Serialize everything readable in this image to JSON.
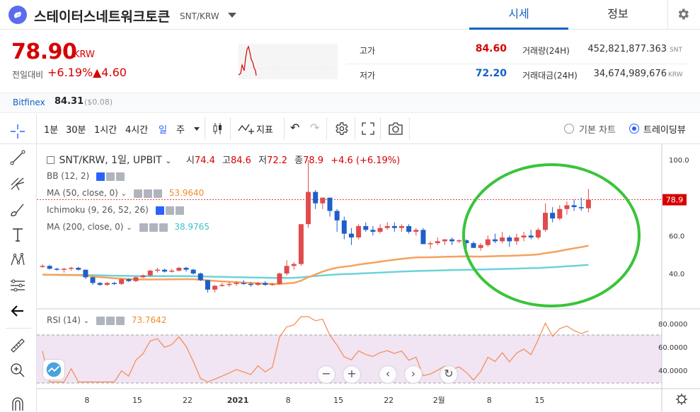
{
  "header": {
    "coin_name": "스테이터스네트워크토큰",
    "pair": "SNT/KRW",
    "tabs": [
      "시세",
      "정보"
    ]
  },
  "price": {
    "current": "78.90",
    "unit": "KRW",
    "change_label": "전일대비",
    "change_pct": "+6.19%",
    "change_abs": "▲4.60"
  },
  "stats": {
    "high_label": "고가",
    "high": "84.60",
    "low_label": "저가",
    "low": "72.20",
    "volume_label": "거래량(24H)",
    "volume": "452,821,877.363",
    "volume_unit": "SNT",
    "value_label": "거래대금(24H)",
    "value": "34,674,989,676",
    "value_unit": "KRW"
  },
  "bitfinex": {
    "name": "Bitfinex",
    "price": "84.31",
    "usd": "($0.08)"
  },
  "toolbar": {
    "intervals": [
      "1분",
      "30분",
      "1시간",
      "4시간",
      "일",
      "주"
    ],
    "active_interval": "일",
    "indicators_label": "지표",
    "basic_chart": "기본 차트",
    "tradingview": "트레이딩뷰"
  },
  "legend": {
    "symbol": "SNT/KRW, 1일, UPBIT",
    "open_lbl": "시",
    "open": "74.4",
    "high_lbl": "고",
    "high": "84.6",
    "low_lbl": "저",
    "low": "72.2",
    "close_lbl": "종",
    "close": "78.9",
    "change": "+4.6 (+6.19%)",
    "bb": "BB (12, 2)",
    "ma50": "MA (50, close, 0)",
    "ma50_val": "53.9640",
    "ichimoku": "Ichimoku (9, 26, 52, 26)",
    "ma200": "MA (200, close, 0)",
    "ma200_val": "38.9765",
    "rsi": "RSI (14)",
    "rsi_val": "73.7642"
  },
  "colors": {
    "up": "#d60000",
    "candle_up": "#e04b4b",
    "candle_down": "#1e5fc9",
    "ma50": "#f5a25d",
    "ma200": "#6dd3d9",
    "rsi": "#f48a50",
    "rsi_band": "#f1e4f3",
    "highlight": "#3ac43a",
    "accent": "#1261c4"
  },
  "chart_data": {
    "type": "candlestick",
    "price_axis": {
      "ticks": [
        100.0,
        80.0,
        60.0,
        40.0
      ],
      "labels": [
        "100.0",
        "80.0",
        "60.0",
        "40.0"
      ],
      "last_price": "78.9"
    },
    "rsi_axis": {
      "ticks": [
        80,
        60,
        40
      ],
      "labels": [
        "80.0000",
        "60.0000",
        "40.0000"
      ]
    },
    "x_ticks": [
      "8",
      "15",
      "22",
      "2021",
      "8",
      "15",
      "22",
      "2월",
      "8",
      "15"
    ],
    "candles": [
      [
        44,
        45,
        43,
        44
      ],
      [
        44,
        44.5,
        42,
        42.5
      ],
      [
        42.5,
        43,
        41.5,
        42
      ],
      [
        42,
        43,
        40.5,
        42.5
      ],
      [
        42.5,
        43.5,
        41.5,
        43
      ],
      [
        43,
        43.5,
        41.5,
        42
      ],
      [
        42,
        42,
        37,
        38
      ],
      [
        38,
        38.5,
        34,
        35
      ],
      [
        35,
        35.5,
        33.5,
        34
      ],
      [
        34,
        35.5,
        33.5,
        35
      ],
      [
        35,
        35.5,
        34,
        34.5
      ],
      [
        34.5,
        37.5,
        34,
        37
      ],
      [
        37,
        37.5,
        35.5,
        36
      ],
      [
        36,
        38.5,
        35.5,
        38
      ],
      [
        38,
        39.5,
        37.5,
        39
      ],
      [
        39,
        42,
        38.5,
        41.5
      ],
      [
        41.5,
        43,
        40.5,
        42
      ],
      [
        42,
        42.5,
        40.5,
        41
      ],
      [
        41,
        42.5,
        40.5,
        41.5
      ],
      [
        41.5,
        43.5,
        41,
        43
      ],
      [
        43,
        43.5,
        41,
        42
      ],
      [
        42,
        42.5,
        39.5,
        40
      ],
      [
        40,
        40.5,
        36,
        36.5
      ],
      [
        36.5,
        36.5,
        30,
        31.5
      ],
      [
        31.5,
        34,
        30,
        33.5
      ],
      [
        33.5,
        35,
        33,
        34
      ],
      [
        34,
        35.5,
        33,
        34.5
      ],
      [
        34.5,
        36,
        33.5,
        35
      ],
      [
        35,
        36.5,
        34,
        34.5
      ],
      [
        34.5,
        35.5,
        33,
        34
      ],
      [
        34,
        35.5,
        33.5,
        35
      ],
      [
        35,
        36,
        33.5,
        34
      ],
      [
        34,
        35,
        33.5,
        34.5
      ],
      [
        34.5,
        40.5,
        34,
        40
      ],
      [
        40,
        47,
        39,
        44
      ],
      [
        44,
        46,
        42,
        45
      ],
      [
        45,
        66,
        44,
        66
      ],
      [
        66,
        100,
        64,
        83
      ],
      [
        83,
        84,
        74,
        77
      ],
      [
        77,
        80,
        74,
        80
      ],
      [
        80,
        79,
        70,
        73
      ],
      [
        73,
        74,
        62,
        68
      ],
      [
        68,
        70,
        58,
        61
      ],
      [
        61,
        64,
        55,
        59
      ],
      [
        59,
        66,
        58,
        65
      ],
      [
        65,
        67,
        62,
        63
      ],
      [
        63,
        65,
        60,
        62
      ],
      [
        62,
        66,
        61,
        64
      ],
      [
        64,
        67,
        63,
        65
      ],
      [
        65,
        67,
        62,
        64
      ],
      [
        64,
        66,
        62,
        65
      ],
      [
        65,
        66,
        61,
        62
      ],
      [
        62,
        64,
        60,
        63
      ],
      [
        63,
        64,
        56,
        55.5
      ],
      [
        55.5,
        57,
        53,
        56
      ],
      [
        56,
        59,
        55,
        57
      ],
      [
        57,
        58,
        55,
        58
      ],
      [
        58,
        59,
        55,
        57
      ],
      [
        57,
        58,
        56,
        57.5
      ],
      [
        57.5,
        58,
        53,
        56
      ],
      [
        56,
        57,
        54,
        53.5
      ],
      [
        53.5,
        56,
        52,
        55
      ],
      [
        55,
        60,
        54,
        58
      ],
      [
        58,
        61,
        56,
        57
      ],
      [
        57,
        62,
        56,
        59
      ],
      [
        59,
        60,
        54,
        57
      ],
      [
        57,
        61,
        55,
        59
      ],
      [
        59,
        62,
        57,
        60
      ],
      [
        60,
        63,
        58,
        59
      ],
      [
        59,
        64,
        58,
        63
      ],
      [
        63,
        77,
        62,
        72
      ],
      [
        72,
        75,
        67,
        69
      ],
      [
        69,
        76,
        68,
        74
      ],
      [
        74,
        78,
        71,
        76
      ],
      [
        76,
        79,
        73,
        75
      ],
      [
        75,
        80,
        73,
        74.4
      ],
      [
        74.4,
        84.6,
        72.2,
        78.9
      ]
    ]
  }
}
